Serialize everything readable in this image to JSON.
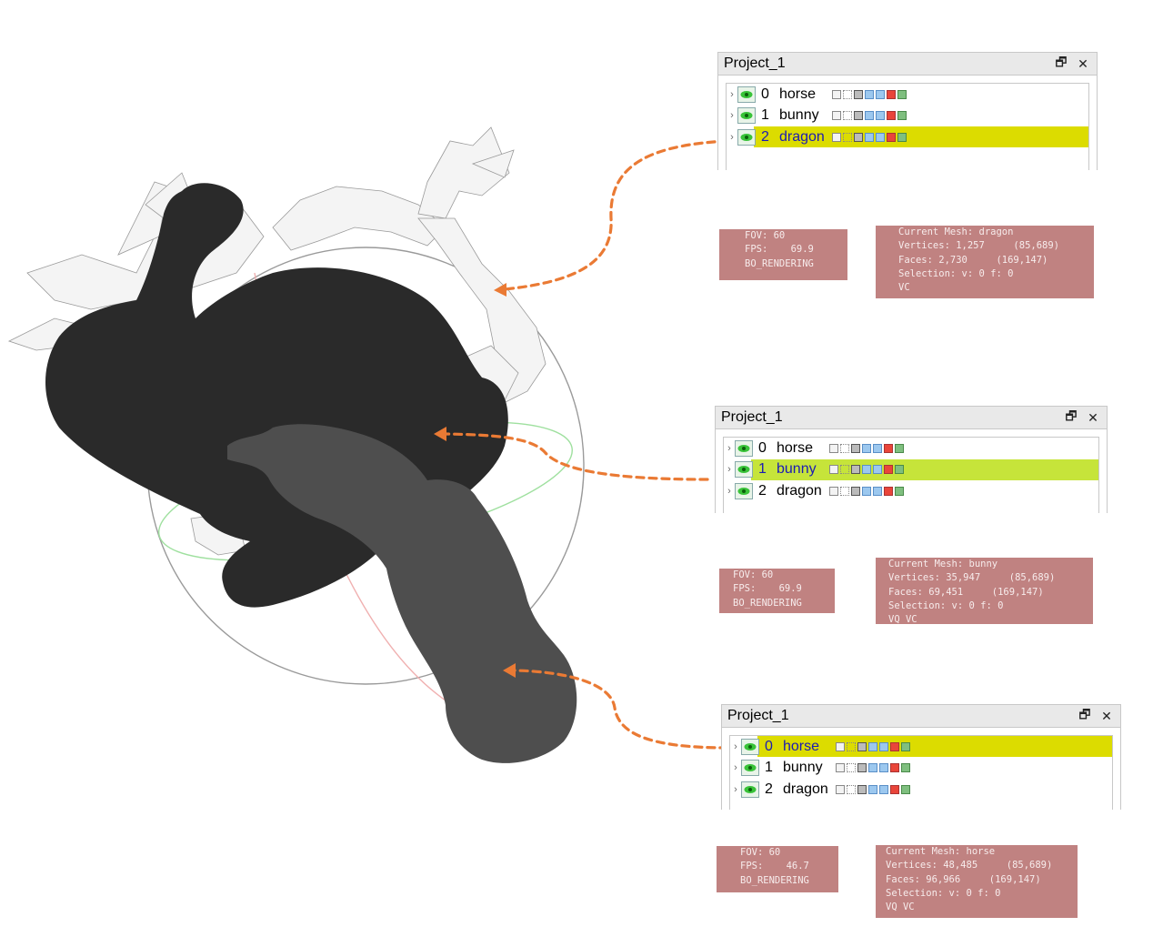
{
  "colors": {
    "arrow": "#ea7a34",
    "highlight_yellow": "#dcdc00",
    "highlight_lime": "#c6e43a",
    "info_bg": "#c08281",
    "info_text": "#f7ecec"
  },
  "panels": [
    {
      "title": "Project_1",
      "restore_icon": "🗗",
      "close_icon": "✕",
      "selected_index": 2,
      "highlight": "yellow",
      "rows": [
        {
          "index": "0",
          "name": "horse"
        },
        {
          "index": "1",
          "name": "bunny"
        },
        {
          "index": "2",
          "name": "dragon"
        }
      ]
    },
    {
      "title": "Project_1",
      "restore_icon": "🗗",
      "close_icon": "✕",
      "selected_index": 1,
      "highlight": "lime",
      "rows": [
        {
          "index": "0",
          "name": "horse"
        },
        {
          "index": "1",
          "name": "bunny"
        },
        {
          "index": "2",
          "name": "dragon"
        }
      ]
    },
    {
      "title": "Project_1",
      "restore_icon": "🗗",
      "close_icon": "✕",
      "selected_index": 0,
      "highlight": "yellow",
      "rows": [
        {
          "index": "0",
          "name": "horse"
        },
        {
          "index": "1",
          "name": "bunny"
        },
        {
          "index": "2",
          "name": "dragon"
        }
      ]
    }
  ],
  "render_info": [
    {
      "lines": [
        "FOV: 60",
        "FPS:    69.9",
        "BO_RENDERING"
      ]
    },
    {
      "lines": [
        "FOV: 60",
        "FPS:    69.9",
        "BO_RENDERING"
      ]
    },
    {
      "lines": [
        "FOV: 60",
        "FPS:    46.7",
        "BO_RENDERING"
      ]
    }
  ],
  "mesh_info": [
    {
      "lines": [
        "Current Mesh: dragon",
        "Vertices: 1,257     (85,689)",
        "Faces: 2,730     (169,147)",
        "Selection: v: 0 f: 0",
        "VC"
      ]
    },
    {
      "lines": [
        "Current Mesh: bunny",
        "Vertices: 35,947     (85,689)",
        "Faces: 69,451     (169,147)",
        "Selection: v: 0 f: 0",
        "VQ VC"
      ]
    },
    {
      "lines": [
        "Current Mesh: horse",
        "Vertices: 48,485     (85,689)",
        "Faces: 96,966     (169,147)",
        "Selection: v: 0 f: 0",
        "VQ VC"
      ]
    }
  ]
}
